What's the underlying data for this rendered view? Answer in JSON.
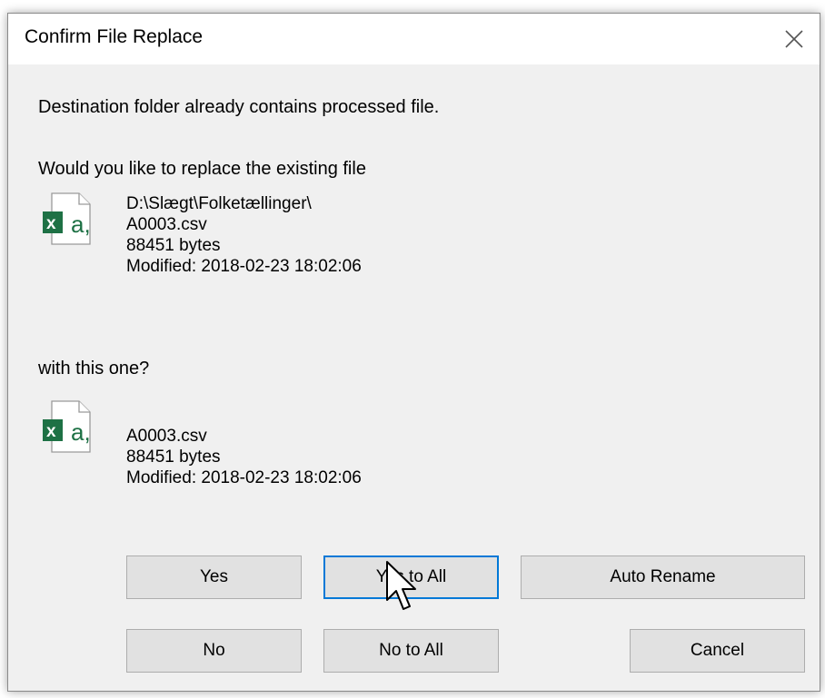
{
  "window": {
    "title": "Confirm File Replace",
    "close_icon": "close-icon"
  },
  "message": {
    "line1": "Destination folder already contains processed file.",
    "question": "Would you like to replace the existing file",
    "with_text": "with this one?"
  },
  "existing_file": {
    "icon": "excel-csv-file-icon",
    "path": "D:\\Slægt\\Folketællinger\\",
    "name": "A0003.csv",
    "size": "88451 bytes",
    "modified": "Modified: 2018-02-23 18:02:06"
  },
  "new_file": {
    "icon": "excel-csv-file-icon",
    "name": "A0003.csv",
    "size": "88451 bytes",
    "modified": "Modified: 2018-02-23 18:02:06"
  },
  "buttons": {
    "yes": "Yes",
    "yes_to_all": "Yes to All",
    "auto_rename": "Auto Rename",
    "no": "No",
    "no_to_all": "No to All",
    "cancel": "Cancel"
  },
  "colors": {
    "dialog_bg": "#f0f0f0",
    "titlebar_bg": "#ffffff",
    "button_bg": "#e1e1e1",
    "button_border": "#adadad",
    "excel_green": "#1e7145"
  }
}
